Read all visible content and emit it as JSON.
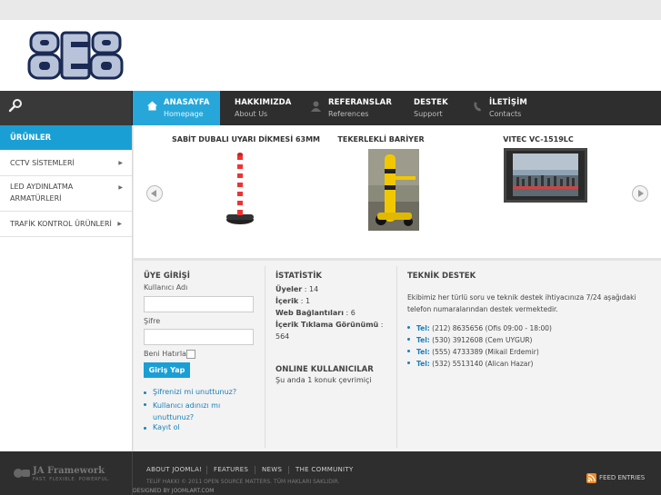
{
  "header": {
    "logo_text": "8EB"
  },
  "nav": {
    "items": [
      {
        "title": "ANASAYFA",
        "sub": "Homepage"
      },
      {
        "title": "HAKKIMIZDA",
        "sub": "About Us"
      },
      {
        "title": "REFERANSLAR",
        "sub": "References"
      },
      {
        "title": "DESTEK",
        "sub": "Support"
      },
      {
        "title": "İLETİŞİM",
        "sub": "Contacts"
      }
    ]
  },
  "sidebar": {
    "title": "ÜRÜNLER",
    "items": [
      {
        "label": "CCTV SİSTEMLERİ"
      },
      {
        "label_line1": "LED AYDINLATMA",
        "label_line2": "ARMATÜRLERİ"
      },
      {
        "label": "TRAFİK KONTROL ÜRÜNLERİ"
      }
    ]
  },
  "carousel": {
    "items": [
      {
        "title": "SABİT DUBALI UYARI DİKMESİ 63MM"
      },
      {
        "title": "TEKERLEKLİ BARİYER"
      },
      {
        "title": "VITEC VC-1519LC"
      }
    ]
  },
  "login": {
    "title": "ÜYE GİRİŞİ",
    "username_label": "Kullanıcı Adı",
    "password_label": "Şifre",
    "remember_label": "Beni Hatırla",
    "button_label": "Giriş Yap",
    "forgot_password": "Şifrenizi mi unuttunuz?",
    "forgot_username_line1": "Kullanıcı adınızı mı",
    "forgot_username_line2": "unuttunuz?",
    "register": "Kayıt ol"
  },
  "stats": {
    "title": "İSTATİSTİK",
    "members_label": "Üyeler",
    "members_value": ": 14",
    "content_label": "İçerik",
    "content_value": ": 1",
    "weblinks_label": "Web Bağlantıları",
    "weblinks_value": ": 6",
    "hits_label": "İçerik Tıklama Görünümü",
    "hits_value": ":",
    "hits_number": "564",
    "online_title": "ONLINE KULLANICILAR",
    "online_text": "Şu anda 1 konuk çevrimiçi"
  },
  "support": {
    "title": "TEKNİK DESTEK",
    "text_line1": "Ekibimiz her türlü soru ve teknik destek ihtiyacınıza 7/24 aşağıdaki",
    "text_line2": "telefon numaralarından destek vermektedir.",
    "phones": [
      {
        "label": "Tel:",
        "value": "(212) 8635656 (Ofis 09:00 - 18:00)"
      },
      {
        "label": "Tel:",
        "value": "(530) 3912608 (Cem UYGUR)"
      },
      {
        "label": "Tel:",
        "value": "(555) 4733389 (Mikail Erdemir)"
      },
      {
        "label": "Tel:",
        "value": "(532) 5513140 (Alican Hazar)"
      }
    ]
  },
  "footer": {
    "brand": "JA Framework",
    "tagline": "FAST. FLEXIBLE. POWERFUL.",
    "links": [
      "ABOUT JOOMLA!",
      "FEATURES",
      "NEWS",
      "THE COMMUNITY"
    ],
    "copyright": "TELİF HAKKI © 2011 OPEN SOURCE MATTERS. TÜM HAKLARI SAKLIDIR.",
    "designed_by": "DESIGNED BY JOOMLART.COM",
    "feed": "FEED ENTRIES"
  },
  "colors": {
    "accent": "#1a9fd4",
    "nav_bg": "#2e2e2e",
    "link": "#1a7fb9"
  }
}
